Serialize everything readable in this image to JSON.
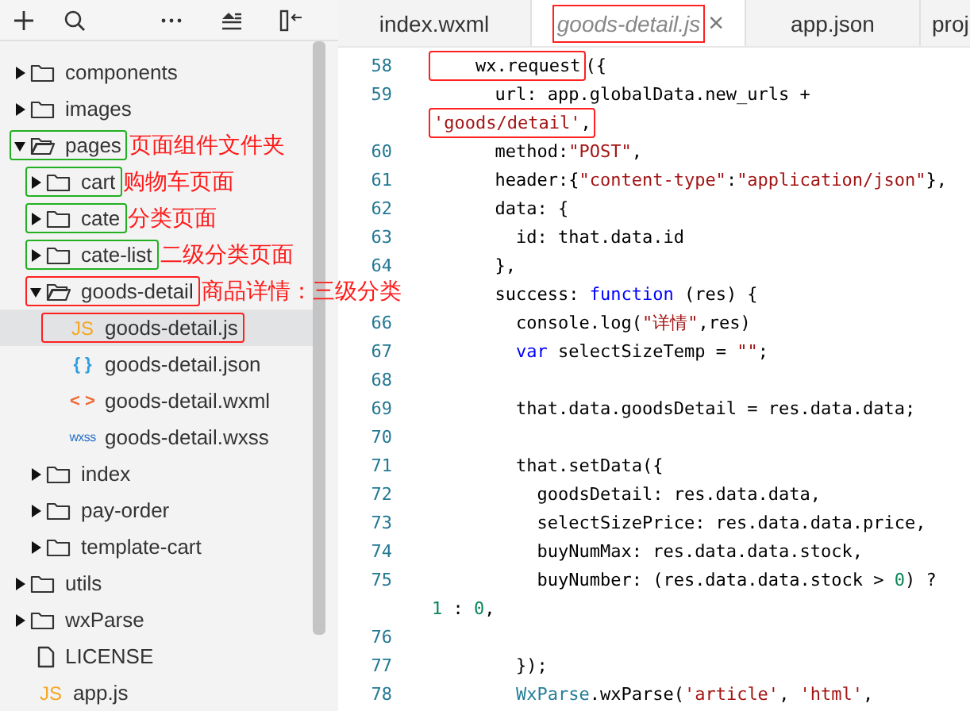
{
  "sidebar": {
    "toolbar": [
      {
        "kind": "add"
      },
      {
        "kind": "search"
      },
      {
        "kind": "more"
      },
      {
        "kind": "sort"
      },
      {
        "kind": "collapse"
      }
    ],
    "tree": [
      {
        "label": "components",
        "kind": "folder",
        "expanded": false,
        "selected": false
      },
      {
        "label": "images",
        "kind": "folder",
        "expanded": false,
        "selected": false
      },
      {
        "label": "pages",
        "kind": "folder",
        "expanded": true,
        "selected": false,
        "color": "#22b022",
        "note": "页面组件文件夹",
        "children": [
          {
            "label": "cart",
            "kind": "folder",
            "expanded": false,
            "selected": false,
            "color": "#22b022",
            "note": "购物车页面"
          },
          {
            "label": "cate",
            "kind": "folder",
            "expanded": false,
            "selected": false,
            "color": "#22b022",
            "note": "分类页面"
          },
          {
            "label": "cate-list",
            "kind": "folder",
            "expanded": false,
            "selected": false,
            "color": "#22b022",
            "note": "二级分类页面"
          },
          {
            "label": "goods-detail",
            "kind": "folder",
            "expanded": true,
            "selected": false,
            "color": "#ff2020",
            "note": "商品详情：三级分类",
            "children": [
              {
                "label": "goods-detail.js",
                "kind": "js",
                "icon_text": "JS",
                "selected": true,
                "color": "#ff2020"
              },
              {
                "label": "goods-detail.json",
                "kind": "json",
                "icon_text": "{ }",
                "selected": false
              },
              {
                "label": "goods-detail.wxml",
                "kind": "wxml",
                "icon_text": "< >",
                "selected": false
              },
              {
                "label": "goods-detail.wxss",
                "kind": "wxss",
                "icon_text": "wxss",
                "selected": false
              }
            ]
          },
          {
            "label": "index",
            "kind": "folder",
            "expanded": false,
            "selected": false
          },
          {
            "label": "pay-order",
            "kind": "folder",
            "expanded": false,
            "selected": false
          },
          {
            "label": "template-cart",
            "kind": "folder",
            "expanded": false,
            "selected": false
          }
        ]
      },
      {
        "label": "utils",
        "kind": "folder",
        "expanded": false,
        "selected": false
      },
      {
        "label": "wxParse",
        "kind": "folder",
        "expanded": false,
        "selected": false
      },
      {
        "label": "LICENSE",
        "kind": "file",
        "selected": false
      },
      {
        "label": "app.js",
        "kind": "js",
        "icon_text": "JS",
        "selected": false
      }
    ]
  },
  "tabs": [
    {
      "label": "index.wxml",
      "selected": false
    },
    {
      "label": "goods-detail.js",
      "selected": true,
      "close": "×",
      "color": "#ff2020"
    },
    {
      "label": "app.json",
      "selected": false
    },
    {
      "label": "proj",
      "selected": false
    }
  ],
  "code": [
    {
      "kind": "line",
      "number": "58",
      "tokens": [
        {
          "text": "    wx.request",
          "kind": "plain",
          "boxed": true
        },
        {
          "text": "({",
          "kind": "plain"
        }
      ]
    },
    {
      "kind": "line",
      "number": "59",
      "tokens": [
        {
          "text": "      url: app.globalData.new_urls +",
          "kind": "plain"
        }
      ]
    },
    {
      "kind": "wrap",
      "tokens": [
        {
          "text": "'goods/detail'",
          "kind": "string",
          "boxed": true
        },
        {
          "text": ",",
          "kind": "plain",
          "boxed": true
        }
      ]
    },
    {
      "kind": "line",
      "number": "60",
      "tokens": [
        {
          "text": "      method:",
          "kind": "plain"
        },
        {
          "text": "\"POST\"",
          "kind": "string"
        },
        {
          "text": ",",
          "kind": "plain"
        }
      ]
    },
    {
      "kind": "line",
      "number": "61",
      "tokens": [
        {
          "text": "      header:{",
          "kind": "plain"
        },
        {
          "text": "\"content-type\"",
          "kind": "string"
        },
        {
          "text": ":",
          "kind": "plain"
        },
        {
          "text": "\"application/json\"",
          "kind": "string"
        },
        {
          "text": "},",
          "kind": "plain"
        }
      ]
    },
    {
      "kind": "line",
      "number": "62",
      "tokens": [
        {
          "text": "      data: {",
          "kind": "plain"
        }
      ]
    },
    {
      "kind": "line",
      "number": "63",
      "tokens": [
        {
          "text": "        id: that.data.id",
          "kind": "plain"
        }
      ]
    },
    {
      "kind": "line",
      "number": "64",
      "tokens": [
        {
          "text": "      },",
          "kind": "plain"
        }
      ]
    },
    {
      "kind": "line",
      "tokens": [
        {
          "text": "      success:",
          "kind": "plain"
        },
        {
          "text": " function",
          "kind": "keyword"
        },
        {
          "text": " (res) {",
          "kind": "plain"
        }
      ]
    },
    {
      "kind": "line",
      "number": "66",
      "tokens": [
        {
          "text": "        console.log(",
          "kind": "plain"
        },
        {
          "text": "\"详情\"",
          "kind": "string"
        },
        {
          "text": ",res)",
          "kind": "plain"
        }
      ]
    },
    {
      "kind": "line",
      "number": "67",
      "tokens": [
        {
          "text": "        var",
          "kind": "keyword"
        },
        {
          "text": " selectSizeTemp =",
          "kind": "plain"
        },
        {
          "text": " \"\"",
          "kind": "string"
        },
        {
          "text": ";",
          "kind": "plain"
        }
      ]
    },
    {
      "kind": "line",
      "number": "68"
    },
    {
      "kind": "line",
      "number": "69",
      "tokens": [
        {
          "text": "        that.data.goodsDetail = res.data.data;",
          "kind": "plain"
        }
      ]
    },
    {
      "kind": "line",
      "number": "70"
    },
    {
      "kind": "line",
      "number": "71",
      "tokens": [
        {
          "text": "        that.setData({",
          "kind": "plain"
        }
      ]
    },
    {
      "kind": "line",
      "number": "72",
      "tokens": [
        {
          "text": "          goodsDetail: res.data.data,",
          "kind": "plain"
        }
      ]
    },
    {
      "kind": "line",
      "number": "73",
      "tokens": [
        {
          "text": "          selectSizePrice: res.data.data.price,",
          "kind": "plain"
        }
      ]
    },
    {
      "kind": "line",
      "number": "74",
      "tokens": [
        {
          "text": "          buyNumMax: res.data.data.stock,",
          "kind": "plain"
        }
      ]
    },
    {
      "kind": "line",
      "number": "75",
      "tokens": [
        {
          "text": "          buyNumber: (res.data.data.stock >",
          "kind": "plain"
        },
        {
          "text": " 0",
          "kind": "number"
        },
        {
          "text": ") ?",
          "kind": "plain"
        }
      ]
    },
    {
      "kind": "wrap",
      "tokens": [
        {
          "text": "1",
          "kind": "number"
        },
        {
          "text": " :",
          "kind": "plain"
        },
        {
          "text": " 0",
          "kind": "number"
        },
        {
          "text": ",",
          "kind": "plain"
        }
      ]
    },
    {
      "kind": "line",
      "number": "76"
    },
    {
      "kind": "line",
      "number": "77",
      "tokens": [
        {
          "text": "        });",
          "kind": "plain"
        }
      ]
    },
    {
      "kind": "line",
      "number": "78",
      "tokens": [
        {
          "text": "        WxParse",
          "kind": "type"
        },
        {
          "text": ".wxParse(",
          "kind": "plain"
        },
        {
          "text": "'article'",
          "kind": "string"
        },
        {
          "text": ",",
          "kind": "plain"
        },
        {
          "text": " 'html'",
          "kind": "string"
        },
        {
          "text": ",",
          "kind": "plain"
        }
      ]
    }
  ]
}
